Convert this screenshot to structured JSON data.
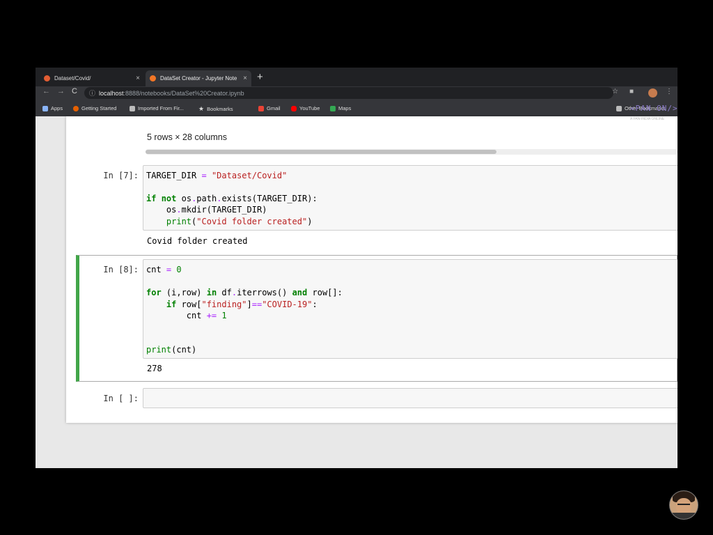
{
  "browser": {
    "tabs": [
      {
        "title": "Dataset/Covid/",
        "close": "×"
      },
      {
        "title": "DataSet Creator - Jupyter Note",
        "close": "×"
      }
    ],
    "new_tab": "+",
    "nav": {
      "back": "←",
      "forward": "→",
      "reload": "C"
    },
    "url": {
      "host": "localhost",
      "path": ":8888/notebooks/DataSet%20Creator.ipynb"
    },
    "bookmarks": [
      {
        "label": "Apps"
      },
      {
        "label": "Getting Started"
      },
      {
        "label": "Imported From Fir..."
      },
      {
        "label": "Bookmarks"
      },
      {
        "label": "Gmail"
      },
      {
        "label": "YouTube"
      },
      {
        "label": "Maps"
      }
    ],
    "other_bookmarks": "Other Bookmarks"
  },
  "notebook": {
    "prev_output_summary": "5 rows × 28 columns",
    "cells": [
      {
        "prompt": "In [7]:",
        "lines": [
          "TARGET_DIR = \"Dataset/Covid\"",
          "",
          "if not os.path.exists(TARGET_DIR):",
          "    os.mkdir(TARGET_DIR)",
          "    print(\"Covid folder created\")"
        ],
        "output": "Covid folder created"
      },
      {
        "prompt": "In [8]:",
        "lines": [
          "cnt = 0",
          "",
          "for (i,row) in df.iterrows() and row[]:",
          "    if row[\"finding\"]==\"COVID-19\":",
          "        cnt += 1",
          "",
          "",
          "print(cnt)"
        ],
        "output": "278"
      },
      {
        "prompt": "In [ ]:",
        "lines": [],
        "output": ""
      }
    ]
  },
  "overlay": {
    "logo": "<PAN ON/>",
    "logo_sub": "A PAN-INDIA ONLINE"
  },
  "colors": {
    "selected_cell_border": "#42a649",
    "keyword": "#008000",
    "string": "#ba2121",
    "operator": "#aa22ff"
  }
}
